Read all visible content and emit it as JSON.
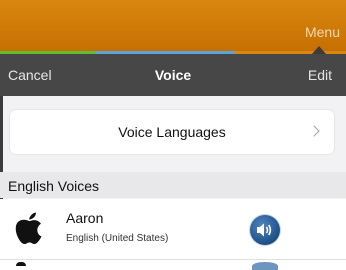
{
  "topbar": {
    "menu_label": "Menu"
  },
  "navbar": {
    "cancel_label": "Cancel",
    "title": "Voice",
    "edit_label": "Edit"
  },
  "languages_card": {
    "label": "Voice Languages"
  },
  "section": {
    "title": "English Voices"
  },
  "voices": [
    {
      "name": "Aaron",
      "language": "English (United States)",
      "icon": "apple-logo-icon",
      "action_icon": "speaker-icon"
    }
  ],
  "colors": {
    "topbar": "#c66f03",
    "navbar": "#474747",
    "tab_green": "#5fbf2f",
    "tab_blue": "#5aa4d8",
    "speaker_button": "#1d4f86"
  }
}
